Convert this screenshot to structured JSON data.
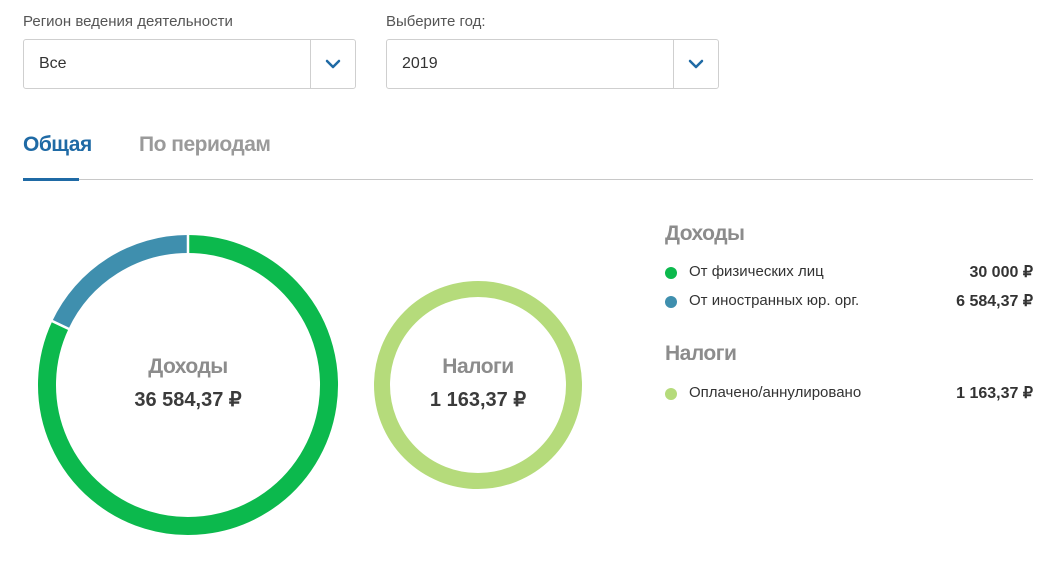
{
  "filters": {
    "region": {
      "label": "Регион ведения деятельности",
      "value": "Все",
      "icon": "chevron-down-icon"
    },
    "year": {
      "label": "Выберите год:",
      "value": "2019",
      "icon": "chevron-down-icon"
    }
  },
  "tabs": [
    {
      "label": "Общая",
      "active": true
    },
    {
      "label": "По периодам",
      "active": false
    }
  ],
  "colors": {
    "accent": "#1f6aa5",
    "income_individuals": "#0cb94d",
    "income_foreign": "#3f8fae",
    "taxes_paid": "#b5db7b"
  },
  "donuts": {
    "income": {
      "title": "Доходы",
      "total": "36 584,37 ₽",
      "segments": [
        {
          "value": 30000,
          "color": "#0cb94d"
        },
        {
          "value": 6584.37,
          "color": "#3f8fae"
        }
      ]
    },
    "taxes": {
      "title": "Налоги",
      "total": "1 163,37 ₽",
      "segments": [
        {
          "value": 1163.37,
          "color": "#b5db7b"
        }
      ]
    }
  },
  "legend": {
    "income": {
      "heading": "Доходы",
      "items": [
        {
          "label": "От физических лиц",
          "value": "30 000 ₽",
          "color": "#0cb94d"
        },
        {
          "label": "От иностранных юр. орг.",
          "value": "6 584,37 ₽",
          "color": "#3f8fae"
        }
      ]
    },
    "taxes": {
      "heading": "Налоги",
      "items": [
        {
          "label": "Оплачено/аннулировано",
          "value": "1 163,37 ₽",
          "color": "#b5db7b"
        }
      ]
    }
  }
}
